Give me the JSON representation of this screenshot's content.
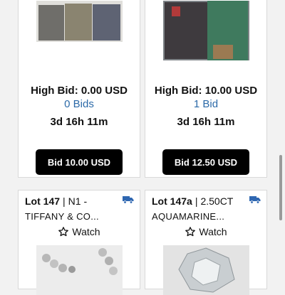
{
  "cards": [
    {
      "image": "pants-photo",
      "high_bid": "High Bid: 0.00 USD",
      "bids": "0 Bids",
      "time_left": "3d 16h 11m",
      "bid_button": "Bid 10.00 USD"
    },
    {
      "image": "jackets-photo",
      "high_bid": "High Bid: 10.00 USD",
      "bids": "1 Bid",
      "time_left": "3d 16h 11m",
      "bid_button": "Bid 12.50 USD"
    },
    {
      "lot": "Lot 147",
      "separator": "|",
      "title_start": "N1 -",
      "title_rest": "TIFFANY & CO...",
      "icon": "truck-icon",
      "watch": "Watch",
      "image": "bracelet-photo"
    },
    {
      "lot": "Lot 147a",
      "separator": "|",
      "title_start": "2.50CT",
      "title_rest": "AQUAMARINE...",
      "icon": "truck-icon",
      "watch": "Watch",
      "image": "gemstone-photo"
    }
  ],
  "colors": {
    "accent_link": "#2c6aa8",
    "button_bg": "#000000",
    "truck": "#2f67b1"
  }
}
